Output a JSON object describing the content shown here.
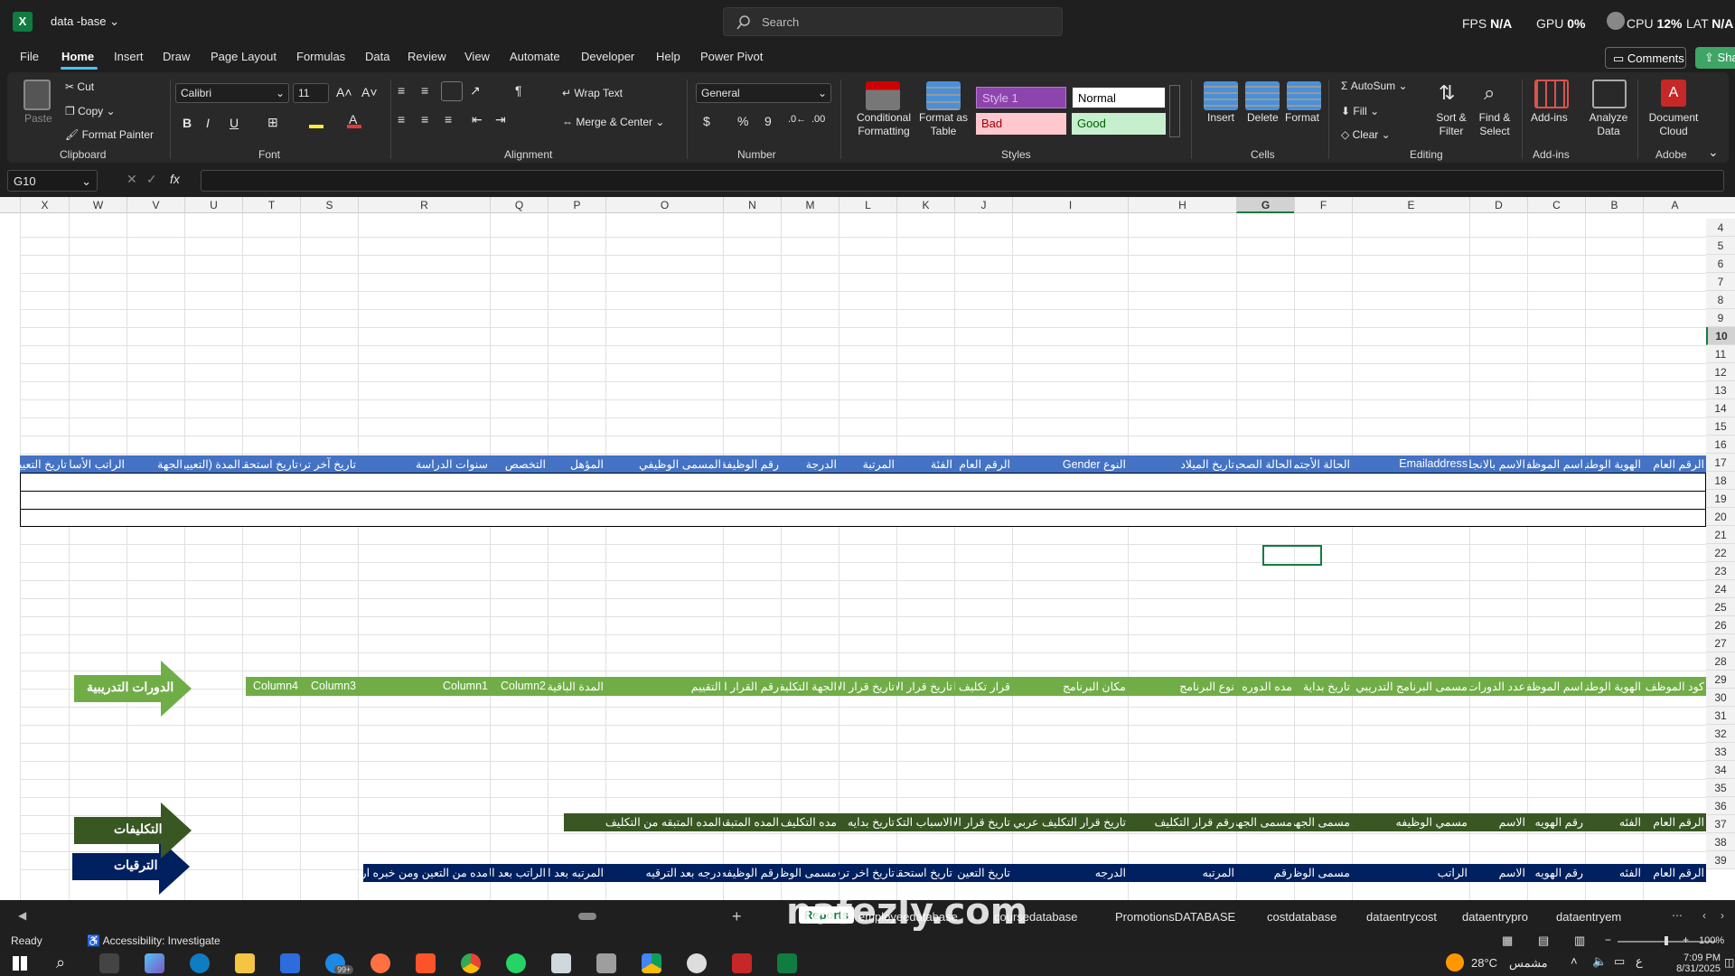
{
  "app": {
    "title": "data -base",
    "search_placeholder": "Search",
    "perf": {
      "fps_label": "FPS",
      "fps_value": "N/A",
      "gpu_label": "GPU",
      "gpu_value": "0%",
      "cpu_label": "CPU",
      "cpu_value": "12%",
      "lat_label": "LAT",
      "lat_value": "N/A"
    }
  },
  "menu": {
    "items": [
      "File",
      "Home",
      "Insert",
      "Draw",
      "Page Layout",
      "Formulas",
      "Data",
      "Review",
      "View",
      "Automate",
      "Developer",
      "Help",
      "Power Pivot"
    ],
    "active": "Home",
    "comments": "Comments",
    "share": "Share"
  },
  "ribbon": {
    "clipboard": {
      "paste": "Paste",
      "cut": "Cut",
      "copy": "Copy",
      "format_painter": "Format Painter",
      "label": "Clipboard"
    },
    "font": {
      "name": "Calibri",
      "size": "11",
      "label": "Font",
      "bold": "B",
      "italic": "I",
      "underline": "U"
    },
    "alignment": {
      "wrap": "Wrap Text",
      "merge": "Merge & Center",
      "label": "Alignment"
    },
    "number": {
      "format": "General",
      "label": "Number",
      "currency": "$",
      "percent": "%",
      "comma": "9"
    },
    "styles": {
      "conditional": "Conditional Formatting",
      "format_table": "Format as Table",
      "style1": "Style 1",
      "normal": "Normal",
      "bad": "Bad",
      "good": "Good",
      "label": "Styles"
    },
    "cells": {
      "insert": "Insert",
      "delete": "Delete",
      "format": "Format",
      "label": "Cells"
    },
    "editing": {
      "autosum": "AutoSum",
      "fill": "Fill",
      "clear": "Clear",
      "sort": "Sort & Filter",
      "find": "Find & Select",
      "label": "Editing"
    },
    "addins": {
      "addins": "Add-ins",
      "analyze": "Analyze Data",
      "label": "Add-ins"
    },
    "adobe": {
      "doc_cloud": "Document Cloud",
      "label": "Adobe"
    }
  },
  "formula_bar": {
    "name_box": "G10",
    "fx": "fx",
    "value": ""
  },
  "columns": [
    "X",
    "W",
    "V",
    "U",
    "T",
    "S",
    "R",
    "Q",
    "P",
    "O",
    "N",
    "M",
    "L",
    "K",
    "J",
    "I",
    "H",
    "G",
    "F",
    "E",
    "D",
    "C",
    "B",
    "A"
  ],
  "selected_column": "G",
  "rows": [
    "4",
    "5",
    "6",
    "7",
    "8",
    "9",
    "10",
    "11",
    "12",
    "13",
    "14",
    "15",
    "16",
    "17",
    "18",
    "19",
    "20",
    "21",
    "22",
    "23",
    "24",
    "25",
    "26",
    "27",
    "28",
    "29",
    "30",
    "31",
    "32",
    "33",
    "34",
    "35",
    "36",
    "37",
    "38",
    "39"
  ],
  "selected_row": "10",
  "header_row5": [
    "الرقم العام",
    "الهوية الوطنية",
    "اسم الموظف",
    "الاسم بالانجليزي",
    "Emailaddress",
    "الحالة الأجتماعية",
    "الحالة الصحية",
    "تاريخ الميلاد",
    "النوع Gender",
    "الرقم العام",
    "الفئة",
    "المرتبة",
    "الدرجة",
    "رقم الوظيفة",
    "المسمى الوظيفي",
    "المؤهل",
    "التخصص",
    "سنوات الدراسة",
    "تاريخ آخر ترقية",
    "تاريخ استحقاق",
    "المدة (التعيين)",
    "الجهة",
    "الراتب الأساسي",
    "تاريخ التعيين"
  ],
  "courses": {
    "arrow_label": "الدورات التدريبية",
    "row17": [
      "كود الموظف",
      "الهوية الوطنية",
      "اسم الموظف",
      "عدد الدورات",
      "مسمى البرنامج التدريبي",
      "تاريخ بداية",
      "مده الدوره",
      "نوع البرنامج",
      "مكان البرنامج",
      "قرار تكليف الدورة",
      "تاريخ قرار الالتحاق",
      "تاريخ قرار الالتحاق",
      "الجهة التكليف",
      "رقم القرار التكليف",
      "التقييم",
      "المدة الباقية",
      "Column2",
      "Column1",
      "Column3",
      "Column4"
    ]
  },
  "promotions": {
    "arrow_label": "الترقيات",
    "row27": [
      "الرقم العام",
      "الفئه",
      "رقم الهويه",
      "الاسم",
      "الراتب",
      "مسمى الوظيفه",
      "رقم",
      "المرتبه",
      "الدرجه",
      "تاريخ التعين",
      "تاريخ استحقاق",
      "تاريخ اخر ترقيه",
      "مسمى الوظيفه",
      "رقم الوظيفه",
      "درجه بعد الترقيه",
      "المرتبه بعد الترقيه",
      "الراتب بعد الترقيه",
      "مده من التعين ومن خبره اربعه"
    ]
  },
  "assignments": {
    "arrow_label": "التكليفات",
    "row35": [
      "الرقم العام",
      "الفئه",
      "رقم الهويه",
      "الاسم",
      "مسمي الوظيفه",
      "مسمى الجهه",
      "مسمى الجهه",
      "رقم قرار التكليف",
      "تاريخ قرار التكليف عربي",
      "تاريخ قرار الاسباب",
      "الاسباب التكليف",
      "تاريخ بدايه",
      "مده التكليف",
      "المده المتبقه",
      "المده المتبقه من التكليف"
    ]
  },
  "sheet_tabs": [
    "Reports",
    "employeedatabase",
    "coursedatabase",
    "PromotionsDATABASE",
    "costdatabase",
    "dataentrycost",
    "dataentrypro",
    "dataentryem"
  ],
  "active_tab": "Reports",
  "status": {
    "ready": "Ready",
    "accessibility": "Accessibility: Investigate",
    "zoom": "100%"
  },
  "taskbar": {
    "weather": "28°C",
    "weather_text": "مشمس",
    "time": "7:09 PM",
    "date": "8/31/2025",
    "badge": "99+"
  },
  "watermark": "nafezly.com",
  "colors": {
    "blue_band": "#4472c4",
    "green_band": "#70ad47",
    "navy_band": "#002060",
    "dark_green_band": "#385723",
    "excel_green": "#107c41",
    "accent": "#4cc2ff"
  }
}
